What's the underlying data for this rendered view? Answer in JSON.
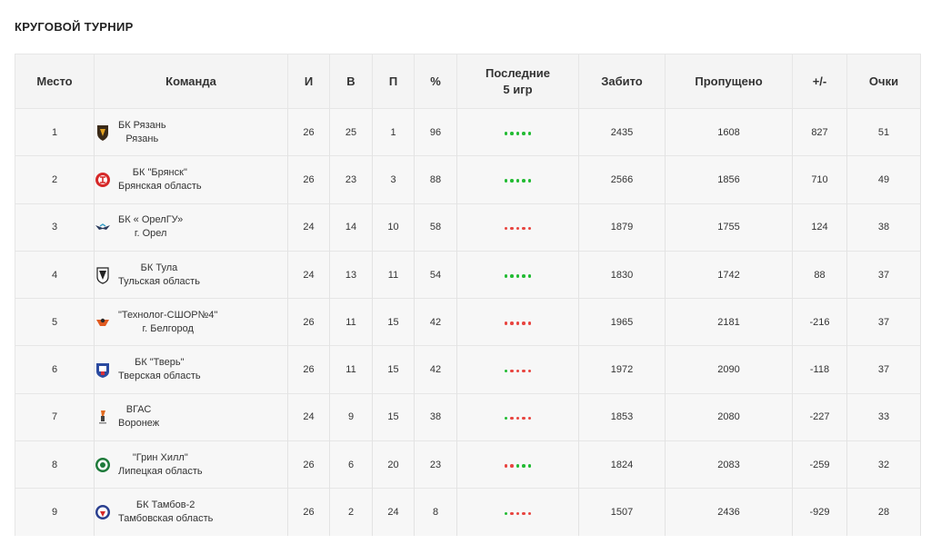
{
  "title": "КРУГОВОЙ ТУРНИР",
  "colors": {
    "win": "#22bb33",
    "loss": "#e8443f",
    "header_bg": "#f4f4f4",
    "row_bg": "#f7f7f7"
  },
  "headers": {
    "place": "Место",
    "team": "Команда",
    "games": "И",
    "wins": "В",
    "losses": "П",
    "percent": "%",
    "last5_line1": "Последние",
    "last5_line2": "5 игр",
    "scored": "Забито",
    "conceded": "Пропущено",
    "diff": "+/-",
    "points": "Очки"
  },
  "rows": [
    {
      "place": "1",
      "name": "БК Рязань",
      "region": "Рязань",
      "logo_icon": "ryazan-logo-icon",
      "games": "26",
      "wins": "25",
      "losses": "1",
      "percent": "96",
      "form": [
        "W",
        "W",
        "W",
        "W",
        "W"
      ],
      "scored": "2435",
      "conceded": "1608",
      "diff": "827",
      "points": "51"
    },
    {
      "place": "2",
      "name": "БК \"Брянск\"",
      "region": "Брянская область",
      "logo_icon": "bryansk-logo-icon",
      "games": "26",
      "wins": "23",
      "losses": "3",
      "percent": "88",
      "form": [
        "W",
        "W",
        "W",
        "W",
        "W"
      ],
      "scored": "2566",
      "conceded": "1856",
      "diff": "710",
      "points": "49"
    },
    {
      "place": "3",
      "name": "БК « ОрелГУ»",
      "region": "г. Орел",
      "logo_icon": "orelgu-logo-icon",
      "games": "24",
      "wins": "14",
      "losses": "10",
      "percent": "58",
      "form": [
        "L",
        "L",
        "L",
        "L",
        "L"
      ],
      "scored": "1879",
      "conceded": "1755",
      "diff": "124",
      "points": "38"
    },
    {
      "place": "4",
      "name": "БК Тула",
      "region": "Тульская область",
      "logo_icon": "tula-logo-icon",
      "games": "24",
      "wins": "13",
      "losses": "11",
      "percent": "54",
      "form": [
        "W",
        "W",
        "W",
        "W",
        "W"
      ],
      "scored": "1830",
      "conceded": "1742",
      "diff": "88",
      "points": "37"
    },
    {
      "place": "5",
      "name": "\"Технолог-СШОР№4\"",
      "region": "г. Белгород",
      "logo_icon": "tekhnolog-logo-icon",
      "games": "26",
      "wins": "11",
      "losses": "15",
      "percent": "42",
      "form": [
        "L",
        "L",
        "L",
        "L",
        "L"
      ],
      "scored": "1965",
      "conceded": "2181",
      "diff": "-216",
      "points": "37"
    },
    {
      "place": "6",
      "name": "БК \"Тверь\"",
      "region": "Тверская область",
      "logo_icon": "tver-logo-icon",
      "games": "26",
      "wins": "11",
      "losses": "15",
      "percent": "42",
      "form": [
        "W",
        "L",
        "L",
        "L",
        "L"
      ],
      "scored": "1972",
      "conceded": "2090",
      "diff": "-118",
      "points": "37"
    },
    {
      "place": "7",
      "name": "ВГАС",
      "region": "Воронеж",
      "logo_icon": "vgas-logo-icon",
      "games": "24",
      "wins": "9",
      "losses": "15",
      "percent": "38",
      "form": [
        "W",
        "L",
        "L",
        "L",
        "L"
      ],
      "scored": "1853",
      "conceded": "2080",
      "diff": "-227",
      "points": "33"
    },
    {
      "place": "8",
      "name": "\"Грин Хилл\"",
      "region": "Липецкая область",
      "logo_icon": "green-hill-logo-icon",
      "games": "26",
      "wins": "6",
      "losses": "20",
      "percent": "23",
      "form": [
        "L",
        "L",
        "W",
        "W",
        "W"
      ],
      "scored": "1824",
      "conceded": "2083",
      "diff": "-259",
      "points": "32"
    },
    {
      "place": "9",
      "name": "БК Тамбов-2",
      "region": "Тамбовская область",
      "logo_icon": "tambov-logo-icon",
      "games": "26",
      "wins": "2",
      "losses": "24",
      "percent": "8",
      "form": [
        "W",
        "L",
        "L",
        "L",
        "L"
      ],
      "scored": "1507",
      "conceded": "2436",
      "diff": "-929",
      "points": "28"
    }
  ]
}
